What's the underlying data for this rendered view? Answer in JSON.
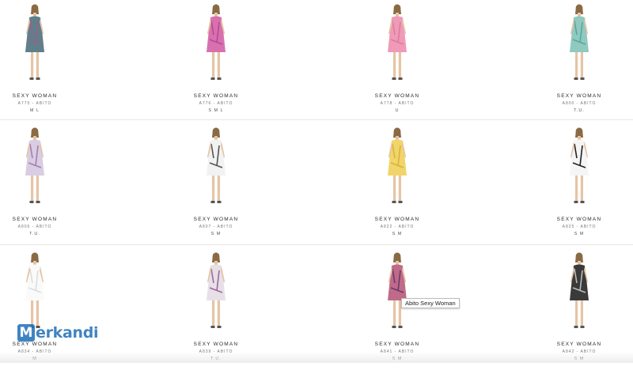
{
  "products": [
    {
      "brand": "SEXY WOMAN",
      "code": "A775 - ABITO",
      "sizes": "M L",
      "dress_color": "#5f7f8a",
      "accent": "#9b5f8c"
    },
    {
      "brand": "SEXY WOMAN",
      "code": "A776 - ABITO",
      "sizes": "S M L",
      "dress_color": "#d870b0",
      "accent": "#b34b8f"
    },
    {
      "brand": "SEXY WOMAN",
      "code": "A778 - ABITO",
      "sizes": "U",
      "dress_color": "#ef9ab8",
      "accent": "#e17a9d"
    },
    {
      "brand": "SEXY WOMAN",
      "code": "A800 - ABITO",
      "sizes": "T.U.",
      "dress_color": "#8fc9c0",
      "accent": "#5aa79c"
    },
    {
      "brand": "SEXY WOMAN",
      "code": "A806 - ABITO",
      "sizes": "T.U.",
      "dress_color": "#d9cde3",
      "accent": "#a47fb0"
    },
    {
      "brand": "SEXY WOMAN",
      "code": "A807 - ABITO",
      "sizes": "S M",
      "dress_color": "#f2f2f2",
      "accent": "#555555"
    },
    {
      "brand": "SEXY WOMAN",
      "code": "A822 - ABITO",
      "sizes": "S M",
      "dress_color": "#f1d56a",
      "accent": "#d9b23c"
    },
    {
      "brand": "SEXY WOMAN",
      "code": "A825 - ABITO",
      "sizes": "S M",
      "dress_color": "#f5f5f5",
      "accent": "#222222"
    },
    {
      "brand": "SEXY WOMAN",
      "code": "A834 - ABITO",
      "sizes": "M",
      "dress_color": "#fafafa",
      "accent": "#dddddd"
    },
    {
      "brand": "SEXY WOMAN",
      "code": "A839 - ABITO",
      "sizes": "T.U.",
      "dress_color": "#e8e0e8",
      "accent": "#9b6a9b"
    },
    {
      "brand": "SEXY WOMAN",
      "code": "A841 - ABITO",
      "sizes": "S M",
      "dress_color": "#c06a8a",
      "accent": "#6a3a6a"
    },
    {
      "brand": "SEXY WOMAN",
      "code": "A842 - ABITO",
      "sizes": "S M",
      "dress_color": "#3a3a3a",
      "accent": "#bbbbbb"
    }
  ],
  "tooltip": {
    "text": "Abito Sexy Woman"
  },
  "watermark": {
    "initial": "M",
    "rest": "erkandi"
  }
}
